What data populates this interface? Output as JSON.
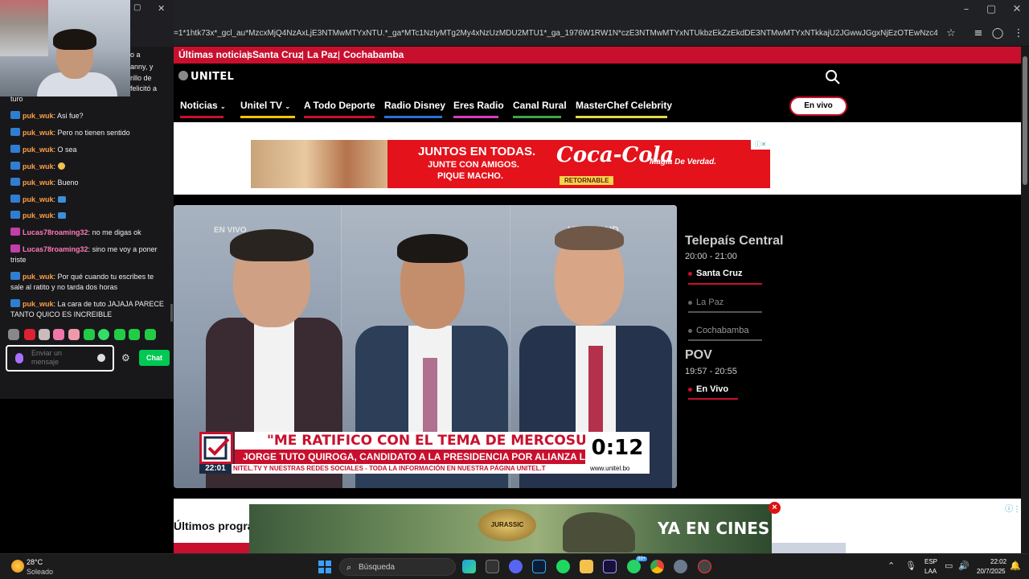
{
  "browser": {
    "url": "=1*1htk73x*_gcl_au*MzcxMjQ4NzAxLjE3NTMwMTYxNTU.*_ga*MTc1NzIyMTg2My4xNzUzMDU2MTU1*_ga_1976W1RW1N*czE3NTMwMTYxNTUkbzEkZzEkdDE3NTMwMTYxNTkkajU2JGwwJGgxNjEzOTEwNzc4"
  },
  "site": {
    "top_links": [
      "Últimas noticias",
      "Santa Cruz",
      "La Paz",
      "Cochabamba"
    ],
    "logo": "UNITEL",
    "nav": [
      {
        "label": "Noticias",
        "color": "#c8102e"
      },
      {
        "label": "Unitel TV",
        "color": "#f5c400"
      },
      {
        "label": "A Todo Deporte",
        "color": "#c8102e"
      },
      {
        "label": "Radio Disney",
        "color": "#2f6fd6"
      },
      {
        "label": "Eres Radio",
        "color": "#d63fbf"
      },
      {
        "label": "Canal Rural",
        "color": "#3fa34d"
      },
      {
        "label": "MasterChef Celebrity",
        "color": "#e6d84a"
      }
    ],
    "live_button": "En vivo",
    "ad": {
      "line1": "JUNTOS EN TODAS.",
      "line2": "JUNTE CON AMIGOS.",
      "line3": "PIQUE MACHO.",
      "brand": "Coca-Cola",
      "retornable": "RETORNABLE",
      "tagline": "Magia De Verdad."
    },
    "video": {
      "live_tag": "EN VIVO",
      "channel_bug": "UNITEL HD",
      "headline": "\"ME RATIFICO CON EL TEMA DE MERCOSUR\"",
      "subline": "JORGE TUTO QUIROGA, CANDIDATO A LA PRESIDENCIA POR ALIANZA LIBRE",
      "timer": "0:12",
      "clock": "22:01",
      "ticker": "NITEL.TV Y NUESTRAS REDES SOCIALES  -  TODA LA INFORMACIÓN EN NUESTRA PÁGINA UNITEL.T",
      "web": "www.unitel.bo"
    },
    "schedule": {
      "program1": {
        "title": "Telepaís Central",
        "time": "20:00 - 21:00"
      },
      "cities": [
        {
          "label": "Santa Cruz",
          "active": true
        },
        {
          "label": "La Paz",
          "active": false
        },
        {
          "label": "Cochabamba",
          "active": false
        }
      ],
      "program2": {
        "title": "POV",
        "time": "19:57 - 20:55",
        "status": "En Vivo"
      }
    },
    "section_title": "Últimos progra",
    "bottom_ad": {
      "brand": "JURASSIC WORLD",
      "text": "YA EN CINES",
      "close": "×"
    }
  },
  "chat": {
    "partial_lines": [
      "o a",
      "anny, y",
      "rillo de",
      "felicitó a"
    ],
    "first_line": "turo",
    "messages": [
      {
        "user": "puk_wuk",
        "text": "Asi fue?",
        "color": "#ff9f43"
      },
      {
        "user": "puk_wuk",
        "text": "Pero no tienen sentido",
        "color": "#ff9f43"
      },
      {
        "user": "puk_wuk",
        "text": "O sea",
        "color": "#ff9f43"
      },
      {
        "user": "puk_wuk",
        "text": "",
        "color": "#ff9f43",
        "emote": "face"
      },
      {
        "user": "puk_wuk",
        "text": "Bueno",
        "color": "#ff9f43"
      },
      {
        "user": "puk_wuk",
        "text": "",
        "color": "#ff9f43",
        "emote": "ok"
      },
      {
        "user": "puk_wuk",
        "text": "",
        "color": "#ff9f43",
        "emote": "ok"
      },
      {
        "user": "Lucas78roaming32",
        "text": "no me digas ok",
        "color": "#ff7ab6"
      },
      {
        "user": "Lucas78roaming32",
        "text": "sino me voy a poner triste",
        "color": "#ff7ab6"
      },
      {
        "user": "puk_wuk",
        "text": "Por qué cuando tu escribes te sale al ratito y no tarda dos horas",
        "color": "#ff9f43"
      },
      {
        "user": "puk_wuk",
        "text": "La cara de tuto JAJAJA PARECE TANTO QUICO ES INCREIBLE",
        "color": "#ff9f43"
      }
    ],
    "input_placeholder": "Enviar un mensaje",
    "send_label": "Chat"
  },
  "taskbar": {
    "temp": "28°C",
    "weather": "Soleado",
    "search": "Búsqueda",
    "lang1": "ESP",
    "lang2": "LAA",
    "time": "22:02",
    "date": "20/7/2025",
    "badge": "99+"
  }
}
